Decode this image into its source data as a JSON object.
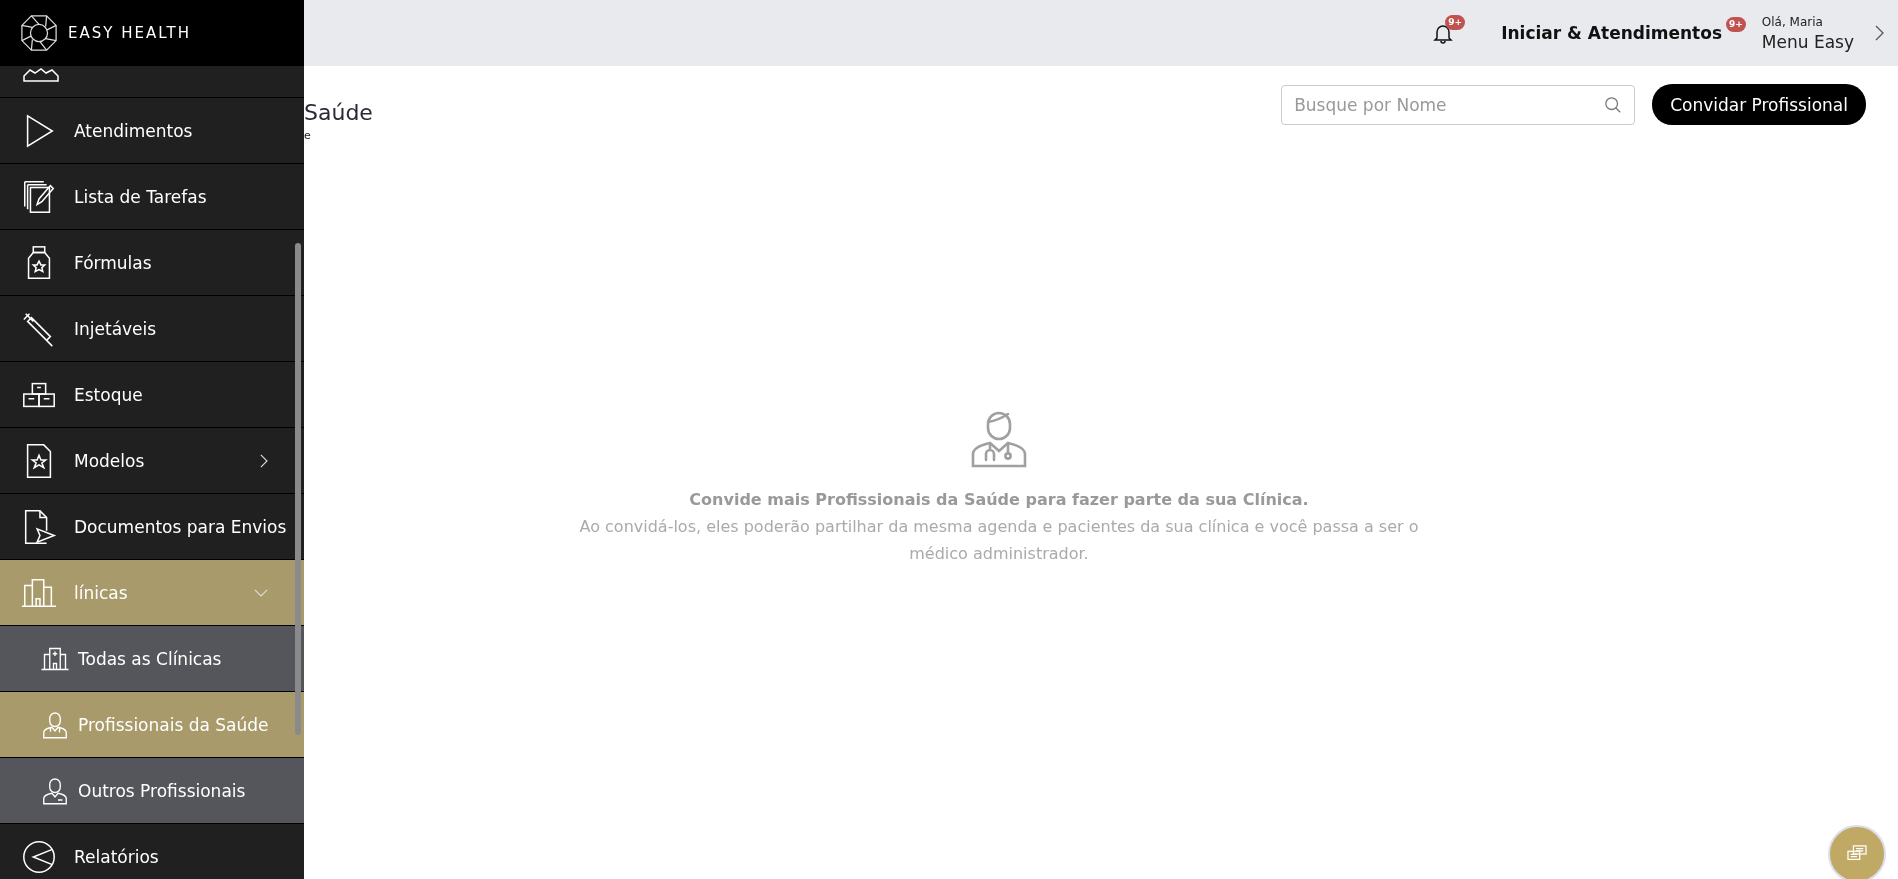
{
  "brand": {
    "name": "EASY HEALTH"
  },
  "header": {
    "notifications_badge": "9+",
    "start_link": "Iniciar & Atendimentos",
    "start_badge": "9+",
    "greeting": "Olá, Maria",
    "menu": "Menu Easy"
  },
  "page": {
    "title": "Saúde",
    "breadcrumb": "e",
    "search": {
      "placeholder": "Busque por Nome"
    },
    "invite_button": "Convidar Profissional"
  },
  "empty_state": {
    "title": "Convide mais Profissionais da Saúde para fazer parte da sua Clínica.",
    "text": "Ao convidá-los, eles poderão partilhar da mesma agenda e pacientes da sua clínica e você passa a ser o médico administrador."
  },
  "sidebar": {
    "items": [
      {
        "kind": "play",
        "label": "Atendimentos",
        "selected": false
      },
      {
        "kind": "tasks",
        "label": "Lista de Tarefas",
        "selected": false
      },
      {
        "kind": "bottle",
        "label": "Fórmulas",
        "selected": false
      },
      {
        "kind": "syringe",
        "label": "Injetáveis",
        "selected": false
      },
      {
        "kind": "boxes",
        "label": "Estoque",
        "selected": false
      },
      {
        "kind": "template",
        "label": "Modelos",
        "selected": false,
        "expanded": false
      },
      {
        "kind": "sendout",
        "label": "Documentos para Envios",
        "selected": false
      },
      {
        "kind": "buildings",
        "label": "línicas",
        "selected": true,
        "expanded": true,
        "children": [
          {
            "kind": "hospital",
            "label": "Todas as Clínicas",
            "selected": false
          },
          {
            "kind": "doctor",
            "label": "Profissionais da Saúde",
            "selected": true
          },
          {
            "kind": "person",
            "label": "Outros Profissionais",
            "selected": false
          }
        ]
      },
      {
        "kind": "pie",
        "label": "Relatórios",
        "selected": false
      }
    ]
  }
}
